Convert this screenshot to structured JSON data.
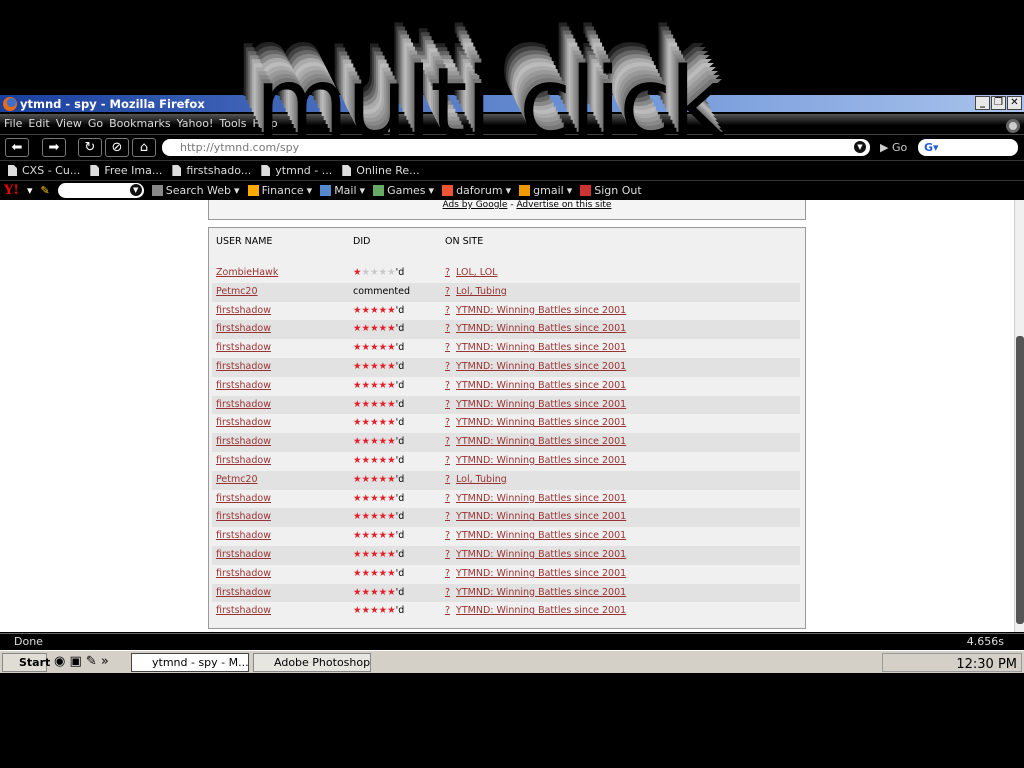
{
  "overlay_text": "multi click",
  "window": {
    "title": "ytmnd - spy - Mozilla Firefox",
    "controls": [
      "_",
      "❐",
      "✕"
    ]
  },
  "menu": [
    "File",
    "Edit",
    "View",
    "Go",
    "Bookmarks",
    "Yahoo!",
    "Tools",
    "Help"
  ],
  "nav": {
    "url": "http://ytmnd.com/spy",
    "go_label": "Go",
    "search_engine": "G"
  },
  "bookmarks": [
    "CXS - Cu...",
    "Free Ima...",
    "firstshado...",
    "ytmnd - ...",
    "Online Re..."
  ],
  "yahoo_toolbar": {
    "logo": "Y!",
    "items": [
      "Search Web",
      "Finance",
      "Mail",
      "Games",
      "daforum",
      "gmail",
      "Sign Out"
    ]
  },
  "ads": {
    "ads_by_google": "Ads by Google",
    "separator": " - ",
    "advertise": "Advertise on this site"
  },
  "table": {
    "headers": [
      "USER NAME",
      "DID",
      "ON SITE"
    ],
    "site_prefix": "?",
    "rows": [
      {
        "user": "ZombieHawk",
        "stars": 1,
        "did": "'d",
        "site": "LOL, LOL"
      },
      {
        "user": "Petmc20",
        "stars": 0,
        "did": "commented",
        "site": "Lol, Tubing"
      },
      {
        "user": "firstshadow",
        "stars": 5,
        "did": "'d",
        "site": "YTMND: Winning Battles since 2001"
      },
      {
        "user": "firstshadow",
        "stars": 5,
        "did": "'d",
        "site": "YTMND: Winning Battles since 2001"
      },
      {
        "user": "firstshadow",
        "stars": 5,
        "did": "'d",
        "site": "YTMND: Winning Battles since 2001"
      },
      {
        "user": "firstshadow",
        "stars": 5,
        "did": "'d",
        "site": "YTMND: Winning Battles since 2001"
      },
      {
        "user": "firstshadow",
        "stars": 5,
        "did": "'d",
        "site": "YTMND: Winning Battles since 2001"
      },
      {
        "user": "firstshadow",
        "stars": 5,
        "did": "'d",
        "site": "YTMND: Winning Battles since 2001"
      },
      {
        "user": "firstshadow",
        "stars": 5,
        "did": "'d",
        "site": "YTMND: Winning Battles since 2001"
      },
      {
        "user": "firstshadow",
        "stars": 5,
        "did": "'d",
        "site": "YTMND: Winning Battles since 2001"
      },
      {
        "user": "firstshadow",
        "stars": 5,
        "did": "'d",
        "site": "YTMND: Winning Battles since 2001"
      },
      {
        "user": "Petmc20",
        "stars": 5,
        "did": "'d",
        "site": "Lol, Tubing"
      },
      {
        "user": "firstshadow",
        "stars": 5,
        "did": "'d",
        "site": "YTMND: Winning Battles since 2001"
      },
      {
        "user": "firstshadow",
        "stars": 5,
        "did": "'d",
        "site": "YTMND: Winning Battles since 2001"
      },
      {
        "user": "firstshadow",
        "stars": 5,
        "did": "'d",
        "site": "YTMND: Winning Battles since 2001"
      },
      {
        "user": "firstshadow",
        "stars": 5,
        "did": "'d",
        "site": "YTMND: Winning Battles since 2001"
      },
      {
        "user": "firstshadow",
        "stars": 5,
        "did": "'d",
        "site": "YTMND: Winning Battles since 2001"
      },
      {
        "user": "firstshadow",
        "stars": 5,
        "did": "'d",
        "site": "YTMND: Winning Battles since 2001"
      },
      {
        "user": "firstshadow",
        "stars": 5,
        "did": "'d",
        "site": "YTMND: Winning Battles since 2001"
      }
    ]
  },
  "status": {
    "text": "Done",
    "timer": "4.656s"
  },
  "taskbar": {
    "start": "Start",
    "tasks": [
      "ytmnd - spy - M...",
      "Adobe Photoshop ..."
    ],
    "clock": "12:30 PM"
  },
  "colors": {
    "link": "#993333",
    "star_on": "#e0202a",
    "star_off": "#c8c8c8",
    "titlebar": "#1a3f9e"
  }
}
